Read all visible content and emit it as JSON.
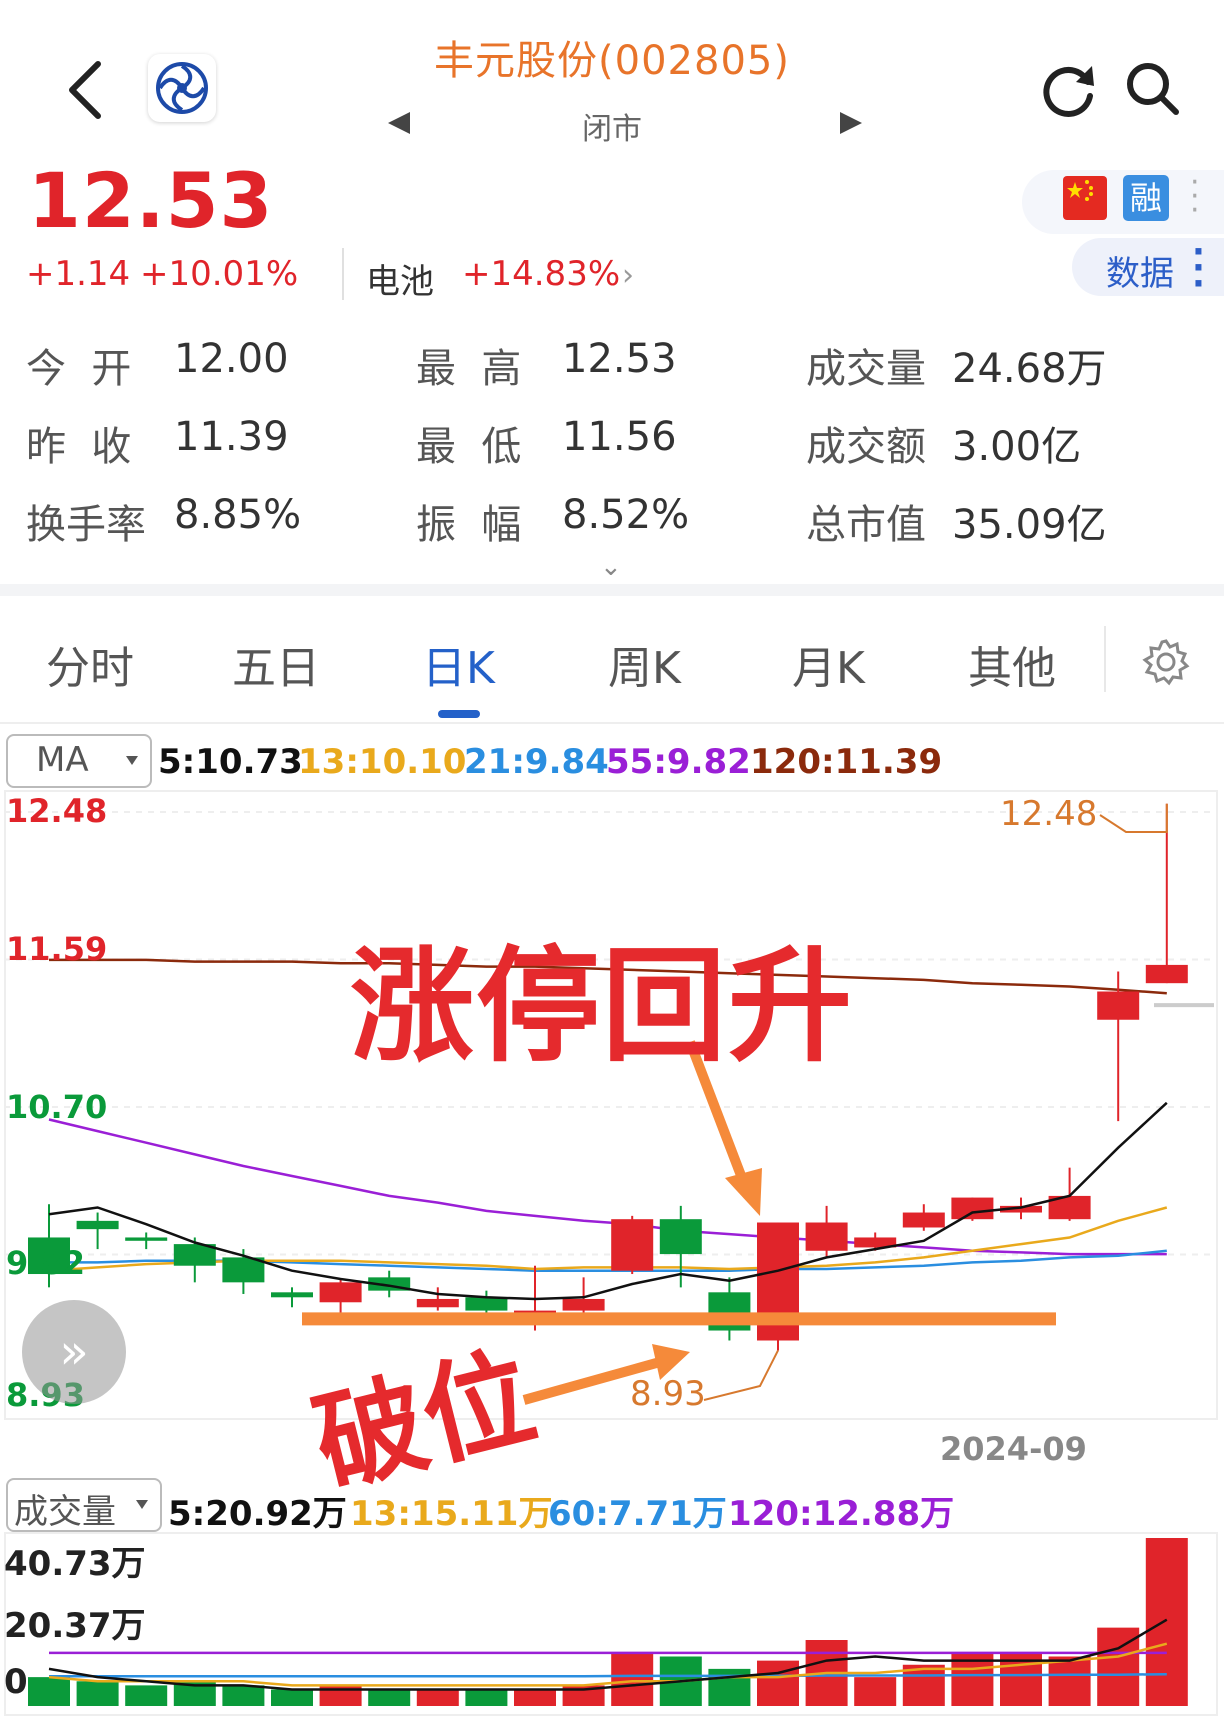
{
  "header": {
    "title": "丰元股份(002805)",
    "status": "闭市",
    "icons": {
      "back": "chevron-left-icon",
      "logo": "company-logo",
      "refresh": "refresh-icon",
      "search": "search-icon",
      "prev": "triangle-left-icon",
      "next": "triangle-right-icon"
    }
  },
  "quote": {
    "price": "12.53",
    "change": "+1.14",
    "change_pct": "+10.01%",
    "sector": "电池",
    "sector_pct": "+14.83%",
    "rong_label": "融",
    "data_label": "数据",
    "color_up": "#e0242a",
    "color_down": "#0a9a3a"
  },
  "stats": [
    {
      "label": "今  开",
      "value": "12.00"
    },
    {
      "label": "最  高",
      "value": "12.53"
    },
    {
      "label": "成交量",
      "value": "24.68万"
    },
    {
      "label": "昨  收",
      "value": "11.39"
    },
    {
      "label": "最  低",
      "value": "11.56"
    },
    {
      "label": "成交额",
      "value": "3.00亿"
    },
    {
      "label": "换手率",
      "value": "8.85%"
    },
    {
      "label": "振  幅",
      "value": "8.52%"
    },
    {
      "label": "总市值",
      "value": "35.09亿"
    }
  ],
  "tabs": [
    {
      "label": "分时"
    },
    {
      "label": "五日"
    },
    {
      "label": "日K"
    },
    {
      "label": "周K"
    },
    {
      "label": "月K"
    },
    {
      "label": "其他"
    }
  ],
  "active_tab": "日K",
  "ma_selector": "MA",
  "ma_values": {
    "ma5": "5:10.73",
    "ma13": "13:10.10",
    "ma21": "21:9.84",
    "ma55": "55:9.82",
    "ma120": "120:11.39",
    "colors": {
      "ma5": "#111111",
      "ma13": "#e9a91c",
      "ma21": "#2a8ee0",
      "ma55": "#9a1fd6",
      "ma120": "#8b2a0c"
    }
  },
  "chart_axis": {
    "top": "12.48",
    "upper": "11.59",
    "mid": "10.70",
    "lower": "9.82",
    "bottom": "8.93"
  },
  "date_label": "2024-09",
  "annotations": {
    "up": "涨停回升",
    "down": "破位",
    "high_label": "12.48",
    "low_label": "8.93"
  },
  "volume": {
    "selector": "成交量",
    "ma5": "5:20.92万",
    "ma13": "13:15.11万",
    "ma60": "60:7.71万",
    "ma120": "120:12.88万",
    "axis_top": "40.73万",
    "axis_mid": "20.37万",
    "axis_zero": "0"
  },
  "chart_data": {
    "type": "candlestick",
    "ylim": [
      8.93,
      12.48
    ],
    "candles": [
      {
        "o": 9.92,
        "c": 9.7,
        "h": 10.12,
        "l": 9.62
      },
      {
        "o": 10.02,
        "c": 9.97,
        "h": 10.07,
        "l": 9.85
      },
      {
        "o": 9.92,
        "c": 9.9,
        "h": 9.95,
        "l": 9.85
      },
      {
        "o": 9.88,
        "c": 9.75,
        "h": 9.92,
        "l": 9.65
      },
      {
        "o": 9.8,
        "c": 9.65,
        "h": 9.85,
        "l": 9.58
      },
      {
        "o": 9.59,
        "c": 9.56,
        "h": 9.62,
        "l": 9.5
      },
      {
        "o": 9.53,
        "c": 9.65,
        "h": 9.67,
        "l": 9.45
      },
      {
        "o": 9.68,
        "c": 9.6,
        "h": 9.72,
        "l": 9.56
      },
      {
        "o": 9.5,
        "c": 9.55,
        "h": 9.62,
        "l": 9.48
      },
      {
        "o": 9.56,
        "c": 9.48,
        "h": 9.6,
        "l": 9.4
      },
      {
        "o": 9.46,
        "c": 9.48,
        "h": 9.75,
        "l": 9.36
      },
      {
        "o": 9.48,
        "c": 9.55,
        "h": 9.68,
        "l": 9.46
      },
      {
        "o": 9.72,
        "c": 10.03,
        "h": 10.05,
        "l": 9.7
      },
      {
        "o": 10.03,
        "c": 9.82,
        "h": 10.11,
        "l": 9.62
      },
      {
        "o": 9.59,
        "c": 9.36,
        "h": 9.68,
        "l": 9.3
      },
      {
        "o": 9.3,
        "c": 10.01,
        "h": 10.01,
        "l": 9.24
      },
      {
        "o": 9.84,
        "c": 10.01,
        "h": 10.11,
        "l": 9.8
      },
      {
        "o": 9.86,
        "c": 9.92,
        "h": 9.95,
        "l": 9.84
      },
      {
        "o": 9.98,
        "c": 10.07,
        "h": 10.12,
        "l": 9.96
      },
      {
        "o": 10.03,
        "c": 10.16,
        "h": 10.16,
        "l": 10.02
      },
      {
        "o": 10.07,
        "c": 10.11,
        "h": 10.16,
        "l": 10.03
      },
      {
        "o": 10.03,
        "c": 10.17,
        "h": 10.34,
        "l": 10.02
      },
      {
        "o": 11.23,
        "c": 11.4,
        "h": 11.52,
        "l": 10.62
      },
      {
        "o": 11.45,
        "c": 11.56,
        "h": 12.53,
        "l": 11.45
      }
    ],
    "ma5": [
      10.06,
      10.1,
      10.0,
      9.89,
      9.81,
      9.72,
      9.67,
      9.63,
      9.58,
      9.56,
      9.55,
      9.56,
      9.64,
      9.7,
      9.66,
      9.72,
      9.8,
      9.85,
      9.9,
      10.07,
      10.1,
      10.17,
      10.46,
      10.73
    ],
    "ma13": [
      9.72,
      9.74,
      9.76,
      9.77,
      9.78,
      9.78,
      9.78,
      9.77,
      9.76,
      9.75,
      9.73,
      9.74,
      9.74,
      9.74,
      9.73,
      9.74,
      9.75,
      9.77,
      9.8,
      9.84,
      9.88,
      9.92,
      10.02,
      10.1
    ],
    "ma21": [
      9.77,
      9.77,
      9.78,
      9.78,
      9.78,
      9.77,
      9.76,
      9.75,
      9.74,
      9.73,
      9.72,
      9.72,
      9.72,
      9.72,
      9.72,
      9.73,
      9.73,
      9.74,
      9.75,
      9.77,
      9.78,
      9.8,
      9.81,
      9.84
    ],
    "ma55": [
      10.63,
      10.56,
      10.49,
      10.42,
      10.35,
      10.29,
      10.23,
      10.17,
      10.13,
      10.08,
      10.05,
      10.02,
      10.0,
      9.96,
      9.94,
      9.92,
      9.9,
      9.88,
      9.86,
      9.84,
      9.83,
      9.82,
      9.82,
      9.82
    ],
    "ma120": [
      11.59,
      11.59,
      11.59,
      11.58,
      11.58,
      11.58,
      11.57,
      11.57,
      11.56,
      11.55,
      11.55,
      11.54,
      11.53,
      11.52,
      11.51,
      11.5,
      11.49,
      11.48,
      11.47,
      11.45,
      11.44,
      11.43,
      11.41,
      11.39
    ],
    "support_line": 9.43,
    "volume_unit": "万",
    "volume_ylim": [
      0,
      40.73
    ],
    "volumes": [
      7,
      6,
      5,
      6,
      5,
      4,
      5,
      4,
      4,
      4,
      4,
      5,
      13,
      12,
      9,
      11,
      16,
      7,
      10,
      13,
      13,
      12,
      19,
      40.73
    ],
    "vol_ma5": [
      9,
      7,
      6,
      5,
      5,
      4,
      4,
      4,
      4,
      4,
      4,
      4,
      5,
      6,
      7,
      8,
      11,
      12,
      11,
      11,
      11,
      11,
      14,
      20.92
    ],
    "vol_ma13": [
      7,
      6,
      6,
      6,
      6,
      5,
      5,
      5,
      5,
      5,
      5,
      5,
      6,
      6,
      7,
      7,
      8,
      8,
      9,
      9,
      10,
      11,
      12,
      15.11
    ],
    "vol_ma60": [
      7.2,
      7.2,
      7.2,
      7.2,
      7.2,
      7.2,
      7.2,
      7.2,
      7.2,
      7.2,
      7.2,
      7.2,
      7.3,
      7.3,
      7.3,
      7.3,
      7.4,
      7.4,
      7.4,
      7.5,
      7.5,
      7.6,
      7.6,
      7.71
    ],
    "vol_ma120": [
      12.88,
      12.88,
      12.88,
      12.88,
      12.88,
      12.88,
      12.88,
      12.88,
      12.88,
      12.88,
      12.88,
      12.88,
      12.88,
      12.88,
      12.88,
      12.88,
      12.88,
      12.88,
      12.88,
      12.88,
      12.88,
      12.88,
      12.88,
      12.88
    ]
  }
}
